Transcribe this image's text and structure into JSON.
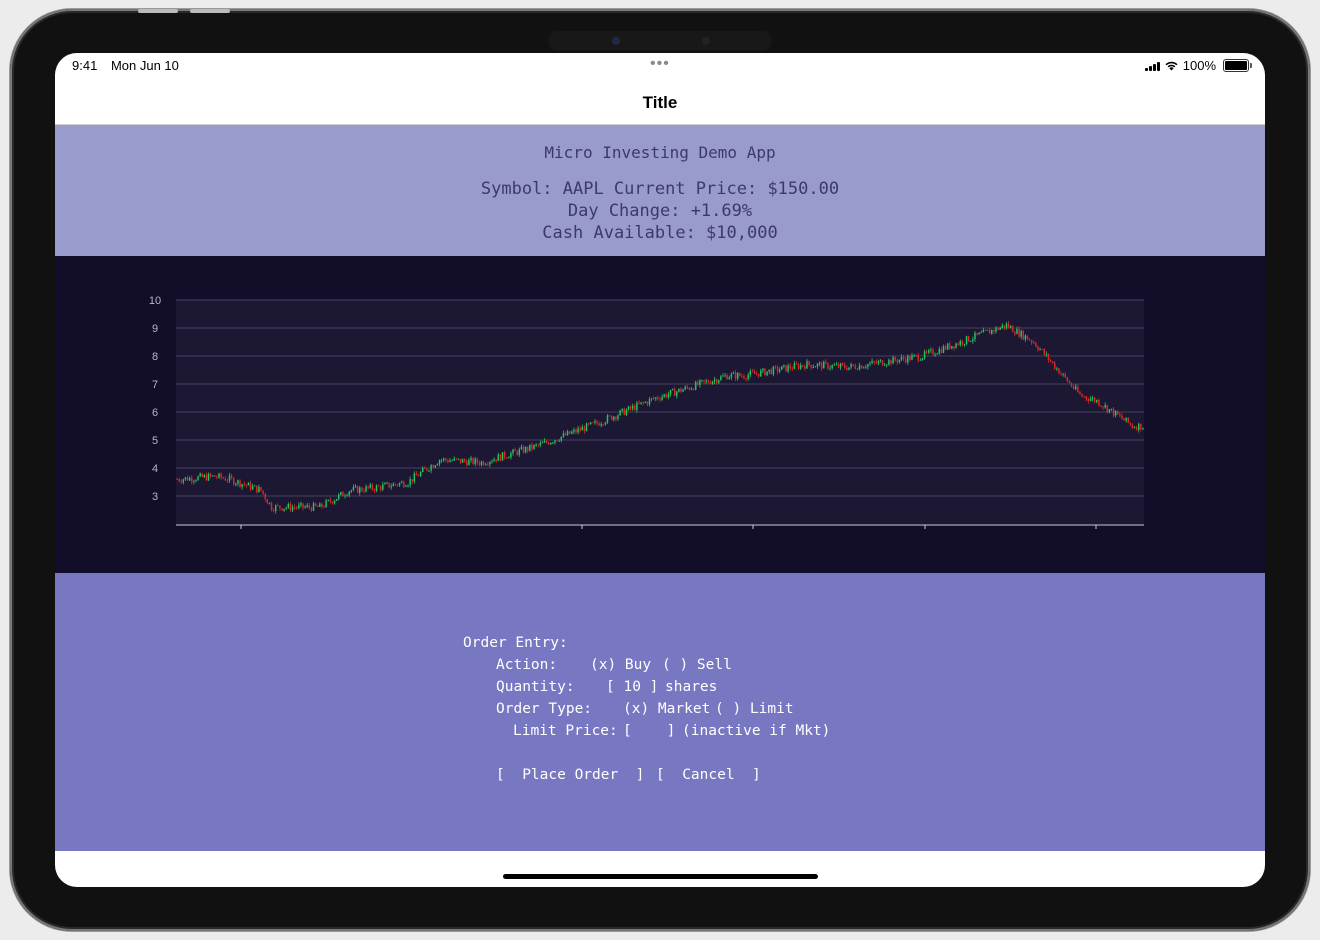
{
  "status_bar": {
    "time": "9:41",
    "date": "Mon Jun 10",
    "multitask_dots": "•••",
    "battery_percent": "100%"
  },
  "nav": {
    "title": "Title"
  },
  "header": {
    "app_name": "Micro Investing Demo App",
    "symbol_line": "Symbol: AAPL Current Price: $150.00",
    "day_change_line": "Day Change: +1.69%",
    "cash_line": "Cash Available: $10,000"
  },
  "chart_data": {
    "type": "candlestick",
    "y_ticks": [
      "10",
      "9",
      "8",
      "7",
      "6",
      "5",
      "4",
      "3"
    ],
    "ylim": [
      2,
      10
    ],
    "x_tick_labels": [],
    "grid": true,
    "up_color": "#22c55e",
    "down_color": "#dc2626",
    "trend_keypoints": {
      "x_index": [
        0,
        18,
        25,
        40,
        45,
        68,
        82,
        95,
        110,
        125,
        145,
        172,
        200,
        228,
        262,
        270,
        300,
        320,
        355,
        395,
        408,
        430,
        438,
        455,
        460
      ],
      "close": [
        3.6,
        3.7,
        3.6,
        3.2,
        2.6,
        2.6,
        3.2,
        3.3,
        3.5,
        4.3,
        4.2,
        4.8,
        5.6,
        6.5,
        7.3,
        7.3,
        7.7,
        7.6,
        8.0,
        9.1,
        8.5,
        6.6,
        6.4,
        5.5,
        5.5
      ]
    }
  },
  "order": {
    "heading": "Order Entry:",
    "action_label": "Action:",
    "action_buy": "(x) Buy",
    "action_sell": "( ) Sell",
    "quantity_label": "Quantity:",
    "quantity_field": "[ 10 ]",
    "quantity_unit": "shares",
    "order_type_label": "Order Type:",
    "order_type_market": "(x) Market",
    "order_type_limit": "( ) Limit",
    "limit_price_label": "Limit Price:",
    "limit_price_field": "[    ]",
    "limit_price_note": "(inactive if Mkt)",
    "place_order_button": "[  Place Order  ]",
    "cancel_button": "[  Cancel  ]"
  },
  "colors": {
    "header_bg": "#9a9bcd",
    "chart_bg": "#120d28",
    "order_bg": "#7877c2"
  }
}
